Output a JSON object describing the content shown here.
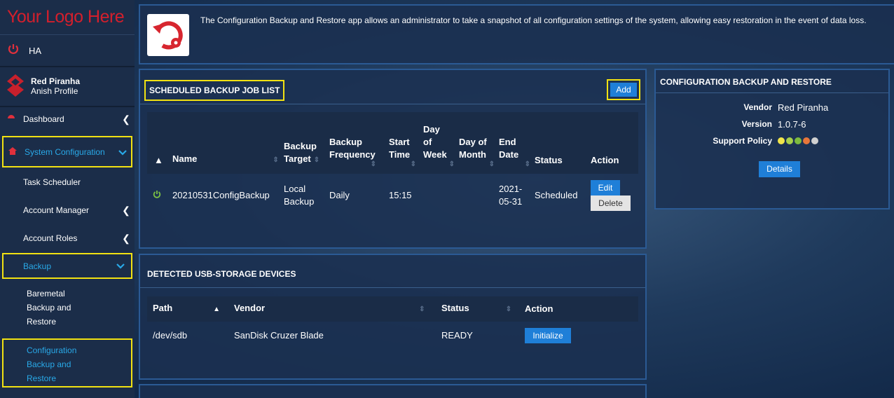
{
  "sidebar": {
    "logo": "Your Logo Here",
    "ha_label": "HA",
    "org_name": "Red Piranha",
    "profile_name": "Anish Profile",
    "items": [
      {
        "label": "Dashboard",
        "icon": "dashboard-icon"
      },
      {
        "label": "System Configuration",
        "icon": "home-icon"
      },
      {
        "label": "Task Scheduler"
      },
      {
        "label": "Account Manager"
      },
      {
        "label": "Account Roles"
      },
      {
        "label": "Backup"
      }
    ],
    "backup_sub": [
      {
        "line1": "Baremetal",
        "line2": "Backup and",
        "line3": "Restore"
      },
      {
        "line1": "Configuration",
        "line2": "Backup and",
        "line3": "Restore"
      }
    ]
  },
  "info": {
    "description": "The Configuration Backup and Restore app allows an administrator to take a snapshot of all configuration settings of the system, allowing easy restoration in the event of data loss."
  },
  "scheduled": {
    "title": "SCHEDULED BACKUP JOB LIST",
    "add_label": "Add",
    "columns": {
      "name": "Name",
      "target": [
        "Backup",
        "Target"
      ],
      "frequency": [
        "Backup",
        "Frequency"
      ],
      "start": [
        "Start",
        "Time"
      ],
      "dow": [
        "Day",
        "of",
        "Week"
      ],
      "dom": [
        "Day of",
        "Month"
      ],
      "end": [
        "End",
        "Date"
      ],
      "status": "Status",
      "action": "Action"
    },
    "row": {
      "name": "20210531ConfigBackup",
      "target": [
        "Local",
        "Backup"
      ],
      "frequency": "Daily",
      "start": "15:15",
      "dow": "",
      "dom": "",
      "end": [
        "2021-",
        "05-31"
      ],
      "status": "Scheduled",
      "edit_label": "Edit",
      "delete_label": "Delete"
    }
  },
  "usb": {
    "title": "DETECTED USB-STORAGE DEVICES",
    "columns": {
      "path": "Path",
      "vendor": "Vendor",
      "status": "Status",
      "action": "Action"
    },
    "row": {
      "path": "/dev/sdb",
      "vendor": "SanDisk Cruzer Blade",
      "status": "READY",
      "init_label": "Initialize"
    }
  },
  "config_panel": {
    "title": "CONFIGURATION BACKUP AND RESTORE",
    "vendor_label": "Vendor",
    "vendor_value": "Red Piranha",
    "version_label": "Version",
    "version_value": "1.0.7-6",
    "support_label": "Support Policy",
    "support_colors": [
      "#f1e54a",
      "#a8d04a",
      "#7dbb3e",
      "#e8763a",
      "#d0d0d0"
    ],
    "details_label": "Details"
  },
  "colors": {
    "accent": "#1f7fd8",
    "highlight": "#f1e112",
    "logo_red": "#d41f2c",
    "active_blue": "#29a9e8"
  }
}
